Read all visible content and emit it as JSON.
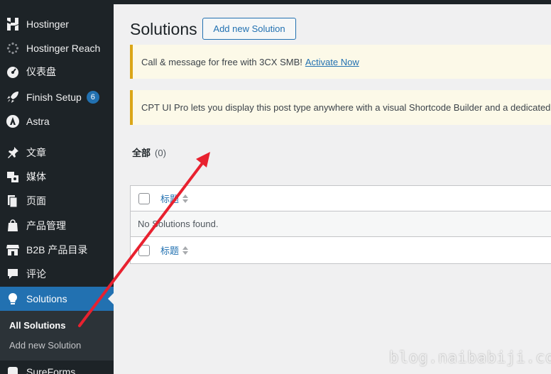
{
  "sidebar": {
    "items": [
      {
        "label": "Hostinger",
        "icon": "hostinger-icon"
      },
      {
        "label": "Hostinger Reach",
        "icon": "reach-icon"
      },
      {
        "label": "仪表盘",
        "icon": "dashboard-icon"
      },
      {
        "label": "Finish Setup",
        "icon": "rocket-icon",
        "badge": "6"
      },
      {
        "label": "Astra",
        "icon": "astra-icon"
      },
      {
        "label": "文章",
        "icon": "pin-icon"
      },
      {
        "label": "媒体",
        "icon": "media-icon"
      },
      {
        "label": "页面",
        "icon": "pages-icon"
      },
      {
        "label": "产品管理",
        "icon": "store-icon"
      },
      {
        "label": "B2B 产品目录",
        "icon": "storefront-icon"
      },
      {
        "label": "评论",
        "icon": "comment-icon"
      },
      {
        "label": "Solutions",
        "icon": "lightbulb-icon"
      },
      {
        "label": "SureForms",
        "icon": "sureforms-icon"
      }
    ],
    "submenu": [
      {
        "label": "All Solutions"
      },
      {
        "label": "Add new Solution"
      }
    ],
    "accent_color": "#2271b1"
  },
  "main": {
    "title": "Solutions",
    "add_button": "Add new Solution",
    "notices": [
      {
        "text": "Call & message for free with 3CX SMB!",
        "link": "Activate Now"
      },
      {
        "text": "CPT UI Pro lets you display this post type anywhere with a visual Shortcode Builder and a dedicated G",
        "link": ""
      }
    ],
    "views": {
      "current": "全部",
      "count": "(0)"
    },
    "table": {
      "column_title": "标题",
      "empty_message": "No Solutions found."
    }
  },
  "watermark": "blog.naibabiji.com"
}
